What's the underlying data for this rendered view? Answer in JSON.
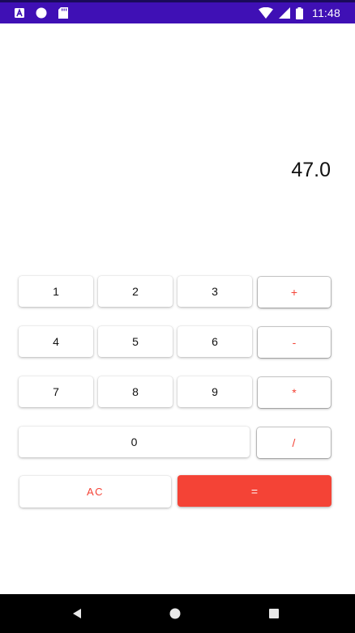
{
  "status_bar": {
    "time": "11:48",
    "left_icons": [
      "app-a-icon",
      "circle-icon",
      "sd-card-icon"
    ],
    "right_icons": [
      "wifi-icon",
      "signal-icon",
      "battery-icon"
    ]
  },
  "display": {
    "value": "47.0"
  },
  "keypad": {
    "digits": {
      "one": "1",
      "two": "2",
      "three": "3",
      "four": "4",
      "five": "5",
      "six": "6",
      "seven": "7",
      "eight": "8",
      "nine": "9",
      "zero": "0"
    },
    "operators": {
      "plus": "+",
      "minus": "-",
      "multiply": "*",
      "divide": "/"
    },
    "clear": "AC",
    "equals": "="
  },
  "colors": {
    "status_bar": "#3f10b5",
    "accent": "#f44336",
    "nav_bar": "#000000"
  },
  "nav_bar": {
    "icons": [
      "back-icon",
      "home-icon",
      "recents-icon"
    ]
  }
}
